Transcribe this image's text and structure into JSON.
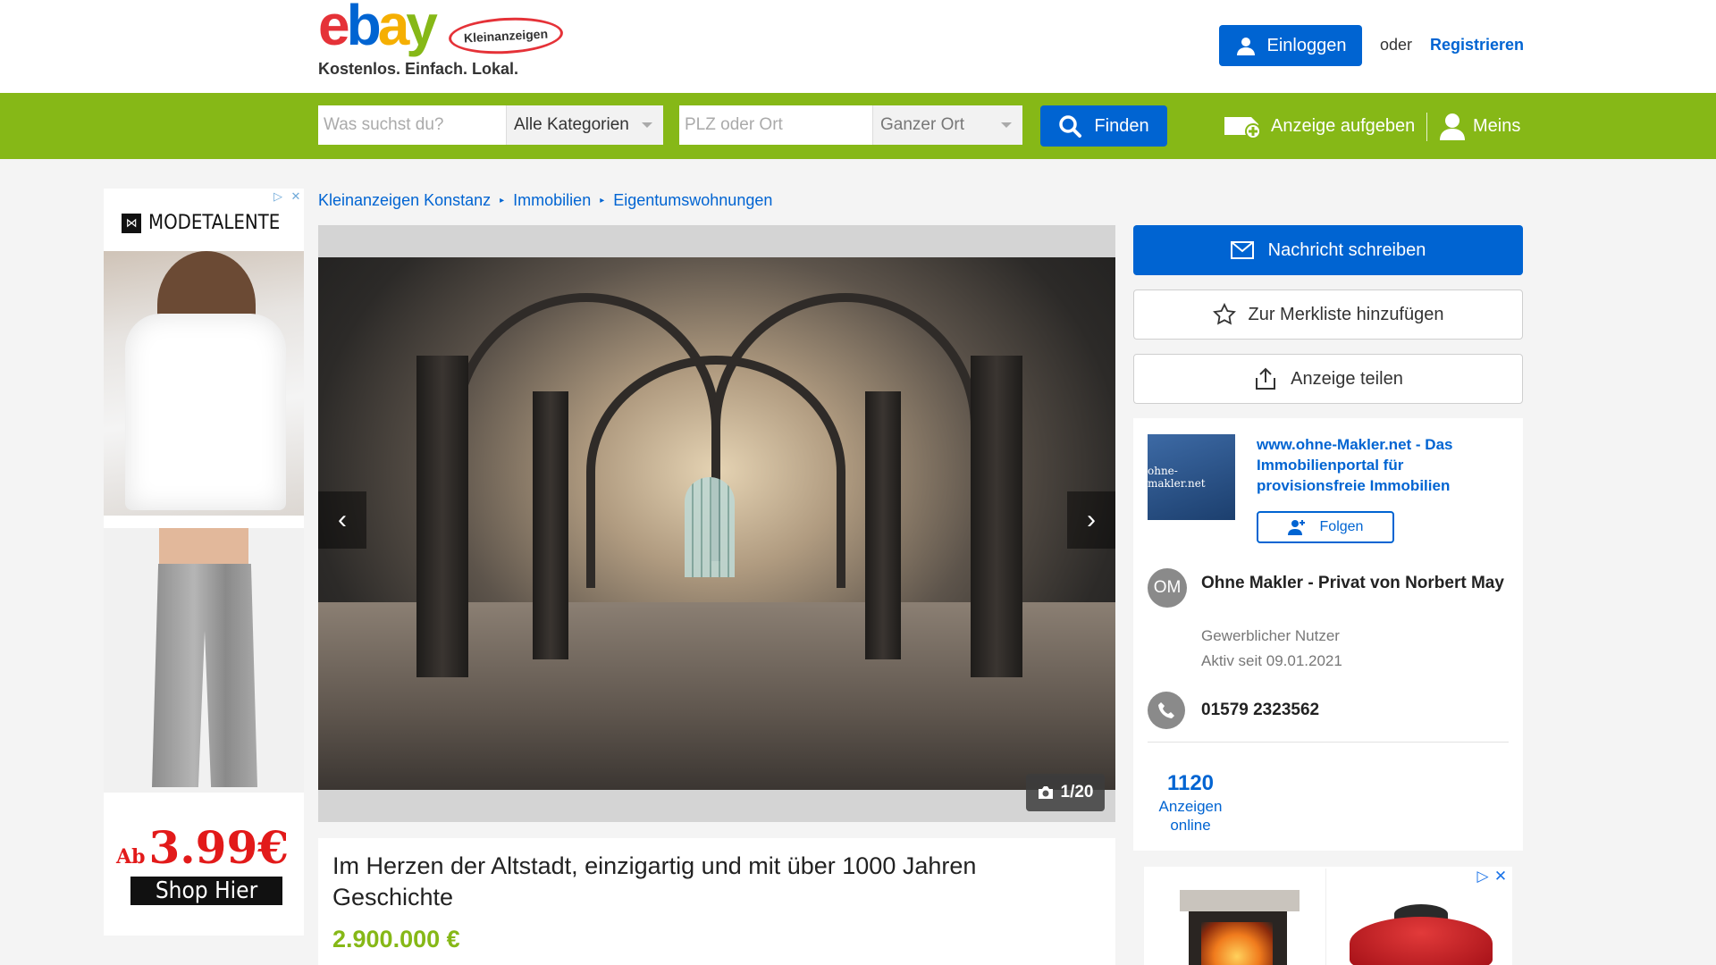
{
  "header": {
    "logo_text": "ebay",
    "logo_sub": "Kleinanzeigen",
    "tagline": "Kostenlos. Einfach. Lokal.",
    "login_label": "Einloggen",
    "or_label": "oder",
    "register_label": "Registrieren"
  },
  "search": {
    "query_placeholder": "Was suchst du?",
    "category_selected": "Alle Kategorien",
    "location_placeholder": "PLZ oder Ort",
    "radius_selected": "Ganzer Ort",
    "find_label": "Finden",
    "post_ad_label": "Anzeige aufgeben",
    "account_label": "Meins"
  },
  "left_ad": {
    "brand": "MODETALENTE",
    "price_prefix": "Ab",
    "price": "3.99€",
    "cta": "Shop Hier"
  },
  "breadcrumb": [
    "Kleinanzeigen Konstanz",
    "Immobilien",
    "Eigentumswohnungen"
  ],
  "gallery": {
    "counter": "1/20",
    "current": 1,
    "total": 20
  },
  "listing": {
    "title": "Im Herzen der Altstadt, einzigartig und mit über 1000 Jahren Geschichte",
    "price": "2.900.000 €"
  },
  "actions": {
    "message_label": "Nachricht schreiben",
    "watchlist_label": "Zur Merkliste hinzufügen",
    "share_label": "Anzeige teilen"
  },
  "seller": {
    "logo_text": "ohne-makler.net",
    "link_text": "www.ohne-Makler.net - Das Immobilienportal für provisionsfreie Immobilien",
    "follow_label": "Folgen",
    "initials": "OM",
    "name": "Ohne Makler - Privat von Norbert May",
    "type": "Gewerblicher Nutzer",
    "active_since": "Aktiv seit 09.01.2021",
    "phone": "01579 2323562",
    "ads_count": "1120",
    "ads_label": "Anzeigen online"
  },
  "colors": {
    "brand_green": "#86b817",
    "brand_blue": "#0064d2",
    "price_green": "#86b817"
  }
}
